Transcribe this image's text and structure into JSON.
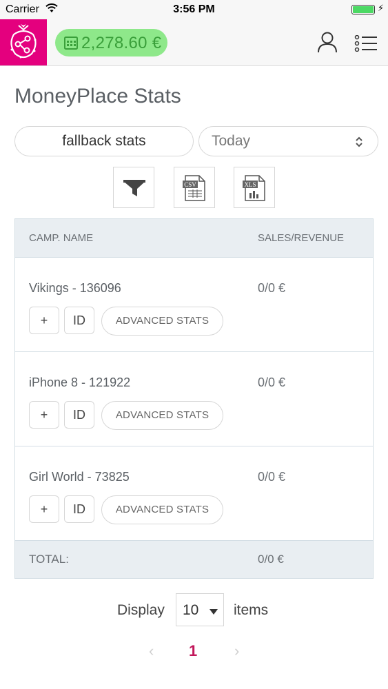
{
  "status_bar": {
    "carrier": "Carrier",
    "time": "3:56 PM",
    "battery_level": 1.0
  },
  "header": {
    "balance": "2,278.60 €",
    "colors": {
      "brand": "#e4007e",
      "balance_bg": "#8ee88a",
      "balance_text": "#3a9f3a"
    }
  },
  "page": {
    "title": "MoneyPlace Stats"
  },
  "controls": {
    "fallback_label": "fallback stats",
    "period_value": "Today",
    "tools": [
      {
        "icon": "filter-icon"
      },
      {
        "icon": "csv-file-icon",
        "badge": "CSV"
      },
      {
        "icon": "xls-file-icon",
        "badge": "XLS"
      }
    ]
  },
  "table": {
    "columns": [
      "CAMP. NAME",
      "SALES/REVENUE"
    ],
    "rows": [
      {
        "name": "Vikings - 136096",
        "revenue": "0/0 €"
      },
      {
        "name": "iPhone 8 - 121922",
        "revenue": "0/0 €"
      },
      {
        "name": "Girl World - 73825",
        "revenue": "0/0 €"
      }
    ],
    "row_buttons": {
      "plus": "+",
      "id": "ID",
      "advanced": "ADVANCED STATS"
    },
    "total_label": "TOTAL:",
    "total_value": "0/0 €"
  },
  "pagination": {
    "display_label": "Display",
    "per_page": "10",
    "items_label": "items",
    "current_page": "1",
    "prev": "‹",
    "next": "›"
  }
}
